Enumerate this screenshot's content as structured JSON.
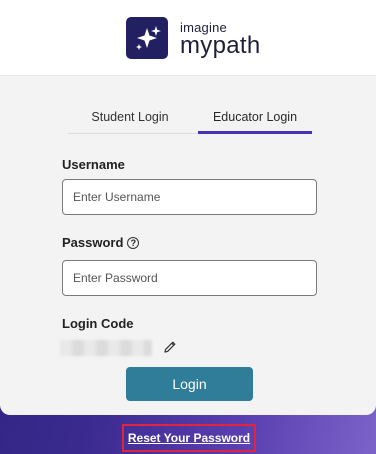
{
  "brand": {
    "small": "imagine",
    "big": "mypath",
    "icon": "sparkle-icon",
    "mark_color": "#232062"
  },
  "tabs": [
    {
      "label": "Student Login",
      "active": false
    },
    {
      "label": "Educator Login",
      "active": true
    }
  ],
  "form": {
    "username_label": "Username",
    "username_placeholder": "Enter Username",
    "username_value": "",
    "password_label": "Password",
    "password_help_icon": "question-circle-icon",
    "password_placeholder": "Enter Password",
    "password_value": "",
    "login_code_label": "Login Code",
    "login_code_edit_icon": "pencil-icon",
    "login_button": "Login"
  },
  "footer": {
    "reset_link": "Reset Your Password"
  },
  "colors": {
    "accent_tab": "#4631b8",
    "button": "#2f7d99",
    "highlight": "#e0253d"
  }
}
